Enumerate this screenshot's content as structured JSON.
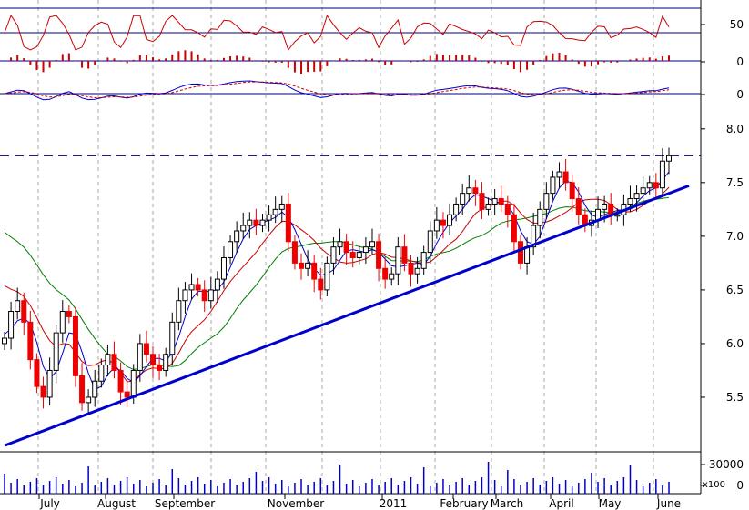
{
  "chart_data": {
    "type": "line",
    "title": "",
    "xlabel": "",
    "ylabel": "",
    "x_month_labels": [
      "July",
      "August",
      "September",
      "November",
      "2011",
      "February",
      "March",
      "April",
      "May",
      "June"
    ],
    "price_axis": {
      "ticks": [
        "8.0",
        "7.5",
        "7.0",
        "6.5",
        "6.0",
        "5.5"
      ],
      "ylim": [
        5.0,
        8.1
      ]
    },
    "rsi_axis": {
      "ticks": [
        "50"
      ]
    },
    "macd_hist_axis": {
      "ticks": [
        "0"
      ]
    },
    "macd_axis": {
      "ticks": [
        "0"
      ]
    },
    "volume_axis": {
      "ticks": [
        "30000",
        "0"
      ],
      "multiplier_label": "x100"
    },
    "resistance_level": 7.75,
    "trendline": {
      "start": [
        "Jun 2010",
        5.05
      ],
      "end": [
        "Jun 2011",
        7.47
      ]
    },
    "series": [
      {
        "name": "",
        "type": "candles",
        "values": [
          6.05,
          6.3,
          6.4,
          6.2,
          5.85,
          5.6,
          5.5,
          5.75,
          6.1,
          6.3,
          6.25,
          5.7,
          5.45,
          5.5,
          5.65,
          5.8,
          5.9,
          5.75,
          5.55,
          5.5,
          5.75,
          6.0,
          5.9,
          5.8,
          5.75,
          5.9,
          6.2,
          6.4,
          6.5,
          6.55,
          6.5,
          6.4,
          6.5,
          6.6,
          6.8,
          6.95,
          7.05,
          7.1,
          7.15,
          7.1,
          7.15,
          7.2,
          7.25,
          7.3,
          6.95,
          6.75,
          6.7,
          6.75,
          6.6,
          6.5,
          6.75,
          6.9,
          6.95,
          6.85,
          6.8,
          6.85,
          6.9,
          6.95,
          6.7,
          6.6,
          6.65,
          6.9,
          6.75,
          6.65,
          6.7,
          6.85,
          7.05,
          7.15,
          7.1,
          7.2,
          7.3,
          7.4,
          7.45,
          7.4,
          7.25,
          7.3,
          7.35,
          7.3,
          7.2,
          6.95,
          6.75,
          6.9,
          7.1,
          7.25,
          7.4,
          7.55,
          7.6,
          7.5,
          7.35,
          7.2,
          7.1,
          7.15,
          7.25,
          7.3,
          7.2,
          7.2,
          7.3,
          7.35,
          7.4,
          7.45,
          7.5,
          7.45,
          7.7,
          7.75
        ]
      },
      {
        "name": "",
        "type": "ma_short",
        "color": "#0000cc"
      },
      {
        "name": "",
        "type": "ma_medium",
        "color": "#cc0000"
      },
      {
        "name": "",
        "type": "ma_long",
        "color": "#008000"
      }
    ]
  },
  "colors": {
    "up": "#000000",
    "down": "#ee0000",
    "ma_short": "#0000cc",
    "ma_medium": "#cc0000",
    "ma_long": "#008000",
    "trendline": "#0000cc",
    "grid": "#aaaaaa"
  }
}
